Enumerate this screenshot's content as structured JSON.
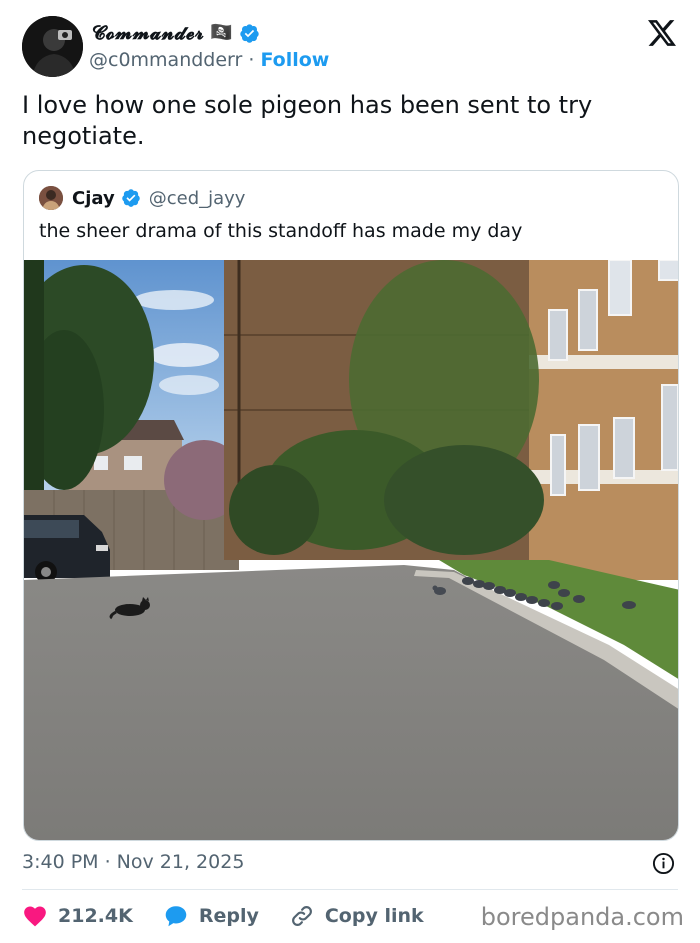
{
  "author": {
    "display_name": "𝓒𝓸𝓶𝓶𝓪𝓷𝓭𝓮𝓻",
    "badge_emoji": "🏴‍☠️",
    "handle": "@c0mmandderr",
    "separator": " · ",
    "follow_label": "Follow",
    "verified_icon": "verified-badge-icon"
  },
  "tweet": {
    "text": "I love how one sole pigeon has been sent to try negotiate."
  },
  "quoted_tweet": {
    "display_name": "Cjay",
    "handle": "@ced_jayy",
    "text": "the sheer drama of this standoff has made my day",
    "image_icon": "standoff-photo"
  },
  "meta": {
    "timestamp": "3:40 PM · Nov 21, 2025",
    "info_icon": "info-icon"
  },
  "actions": {
    "likes": "212.4K",
    "reply_label": "Reply",
    "copy_link_label": "Copy link"
  },
  "watermark": "boredpanda.com",
  "colors": {
    "accent": "#1d9bf0",
    "like": "#f91880",
    "muted": "#536471",
    "text": "#0f1419"
  }
}
